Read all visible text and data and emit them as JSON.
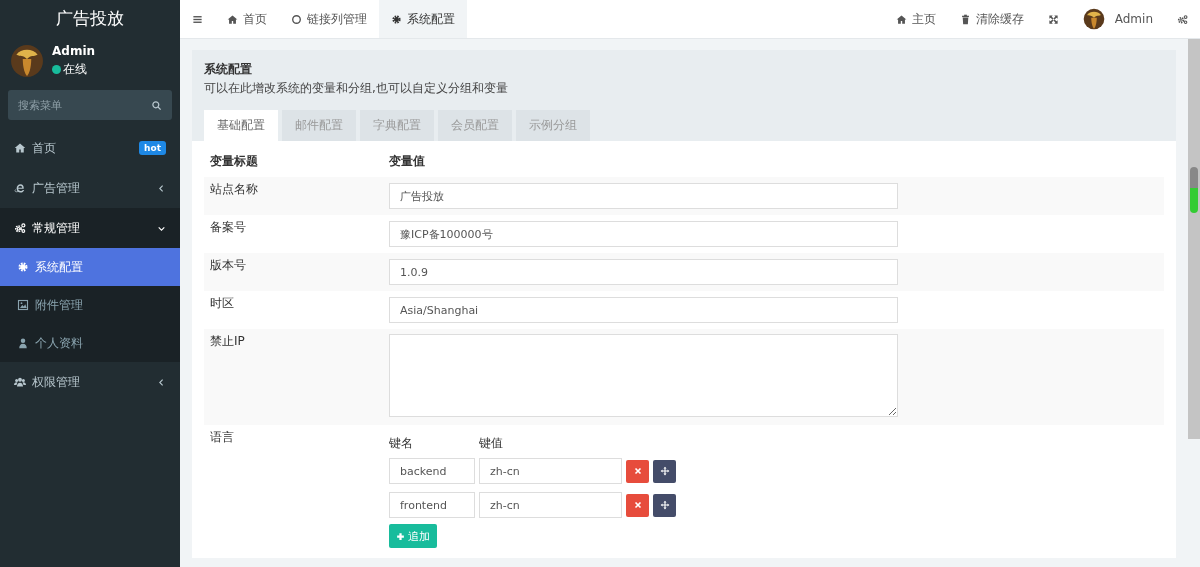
{
  "sidebar": {
    "title": "广告投放",
    "user": {
      "name": "Admin",
      "status": "在线"
    },
    "search": {
      "placeholder": "搜索菜单"
    },
    "items": [
      {
        "label": "首页",
        "badge": "hot",
        "selected": false
      },
      {
        "label": "广告管理",
        "expanded": false,
        "selected": false
      },
      {
        "label": "常规管理",
        "expanded": true,
        "selected": false,
        "children": [
          {
            "label": "系统配置",
            "selected": true
          },
          {
            "label": "附件管理",
            "selected": false
          },
          {
            "label": "个人资料",
            "selected": false
          }
        ]
      },
      {
        "label": "权限管理",
        "expanded": false,
        "selected": false
      }
    ]
  },
  "topbar": {
    "tabs": [
      {
        "label": "首页",
        "selected": false
      },
      {
        "label": "链接列管理",
        "selected": false
      },
      {
        "label": "系统配置",
        "selected": true
      }
    ],
    "links": [
      {
        "label": "主页"
      },
      {
        "label": "清除缓存"
      }
    ],
    "user": "Admin"
  },
  "panel": {
    "title": "系统配置",
    "description": "可以在此增改系统的变量和分组,也可以自定义分组和变量",
    "tabs": [
      {
        "label": "基础配置",
        "selected": true
      },
      {
        "label": "邮件配置",
        "selected": false
      },
      {
        "label": "字典配置",
        "selected": false
      },
      {
        "label": "会员配置",
        "selected": false
      },
      {
        "label": "示例分组",
        "selected": false
      }
    ],
    "columns": [
      "变量标题",
      "变量值"
    ],
    "rows": [
      {
        "label": "站点名称",
        "kind": "input",
        "value": "广告投放"
      },
      {
        "label": "备案号",
        "kind": "input",
        "value": "豫ICP备100000号"
      },
      {
        "label": "版本号",
        "kind": "input",
        "value": "1.0.9"
      },
      {
        "label": "时区",
        "kind": "input",
        "value": "Asia/Shanghai"
      },
      {
        "label": "禁止IP",
        "kind": "textarea"
      },
      {
        "label": "语言",
        "kind": "keyvalue",
        "headers": [
          "键名",
          "键值"
        ],
        "pairs": [
          {
            "key": "backend",
            "value": "zh-cn"
          },
          {
            "key": "frontend",
            "value": "zh-cn"
          }
        ],
        "add_button": "追加"
      }
    ]
  }
}
